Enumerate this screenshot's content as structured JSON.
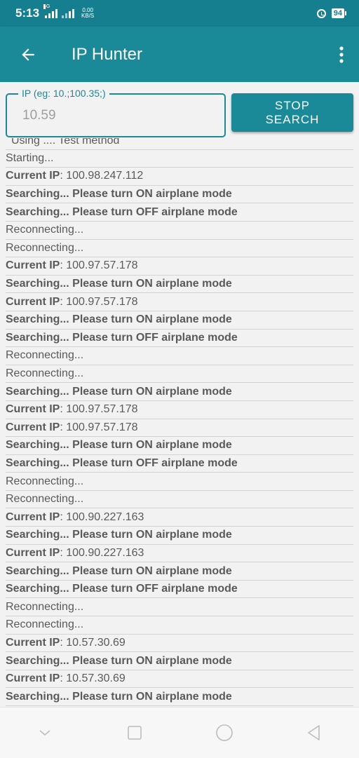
{
  "status_bar": {
    "time": "5:13",
    "network_type": "4G",
    "speed_value": "0.00",
    "speed_unit": "KB/S",
    "battery": "94",
    "icons": [
      "signal-icon",
      "alarm-icon",
      "battery-icon"
    ]
  },
  "app_bar": {
    "title": "IP Hunter",
    "back_icon": "arrow-back-icon",
    "menu_icon": "more-vert-icon"
  },
  "search": {
    "label": "IP (eg: 10.;100.35;)",
    "value": "10.59"
  },
  "stop_button": {
    "line1": "STOP",
    "line2": "SEARCH"
  },
  "log": {
    "partial_top": "Using .... Test method",
    "entries": [
      {
        "prefix": "",
        "text": "Starting...",
        "bold": false
      },
      {
        "prefix": "Current IP",
        "text": ": 100.98.247.112",
        "bold": false
      },
      {
        "prefix": "",
        "text": "Searching... Please turn ON airplane mode",
        "bold": true
      },
      {
        "prefix": "",
        "text": "Searching... Please turn OFF airplane mode",
        "bold": true
      },
      {
        "prefix": "",
        "text": "Reconnecting...",
        "bold": false
      },
      {
        "prefix": "",
        "text": "Reconnecting...",
        "bold": false
      },
      {
        "prefix": "Current IP",
        "text": ": 100.97.57.178",
        "bold": false
      },
      {
        "prefix": "",
        "text": "Searching... Please turn ON airplane mode",
        "bold": true
      },
      {
        "prefix": "Current IP",
        "text": ": 100.97.57.178",
        "bold": false
      },
      {
        "prefix": "",
        "text": "Searching... Please turn ON airplane mode",
        "bold": true
      },
      {
        "prefix": "",
        "text": "Searching... Please turn OFF airplane mode",
        "bold": true
      },
      {
        "prefix": "",
        "text": "Reconnecting...",
        "bold": false
      },
      {
        "prefix": "",
        "text": "Reconnecting...",
        "bold": false
      },
      {
        "prefix": "",
        "text": "Searching... Please turn ON airplane mode",
        "bold": true
      },
      {
        "prefix": "Current IP",
        "text": ": 100.97.57.178",
        "bold": false
      },
      {
        "prefix": "Current IP",
        "text": ": 100.97.57.178",
        "bold": false
      },
      {
        "prefix": "",
        "text": "Searching... Please turn ON airplane mode",
        "bold": true
      },
      {
        "prefix": "",
        "text": "Searching... Please turn OFF airplane mode",
        "bold": true
      },
      {
        "prefix": "",
        "text": "Reconnecting...",
        "bold": false
      },
      {
        "prefix": "",
        "text": "Reconnecting...",
        "bold": false
      },
      {
        "prefix": "Current IP",
        "text": ": 100.90.227.163",
        "bold": false
      },
      {
        "prefix": "",
        "text": "Searching... Please turn ON airplane mode",
        "bold": true
      },
      {
        "prefix": "Current IP",
        "text": ": 100.90.227.163",
        "bold": false
      },
      {
        "prefix": "",
        "text": "Searching... Please turn ON airplane mode",
        "bold": true
      },
      {
        "prefix": "",
        "text": "Searching... Please turn OFF airplane mode",
        "bold": true
      },
      {
        "prefix": "",
        "text": "Reconnecting...",
        "bold": false
      },
      {
        "prefix": "",
        "text": "Reconnecting...",
        "bold": false
      },
      {
        "prefix": "Current IP",
        "text": ": 10.57.30.69",
        "bold": false
      },
      {
        "prefix": "",
        "text": "Searching... Please turn ON airplane mode",
        "bold": true
      },
      {
        "prefix": "Current IP",
        "text": ": 10.57.30.69",
        "bold": false
      },
      {
        "prefix": "",
        "text": "Searching... Please turn ON airplane mode",
        "bold": true
      }
    ]
  },
  "nav_bar": {
    "icons": [
      "nav-down-icon",
      "recent-apps-icon",
      "home-icon",
      "back-triangle-icon"
    ]
  },
  "colors": {
    "primary": "#1a8a99",
    "status_bar": "#167f8f",
    "background": "#f2f2f2",
    "log_text": "#5a5a5a"
  }
}
